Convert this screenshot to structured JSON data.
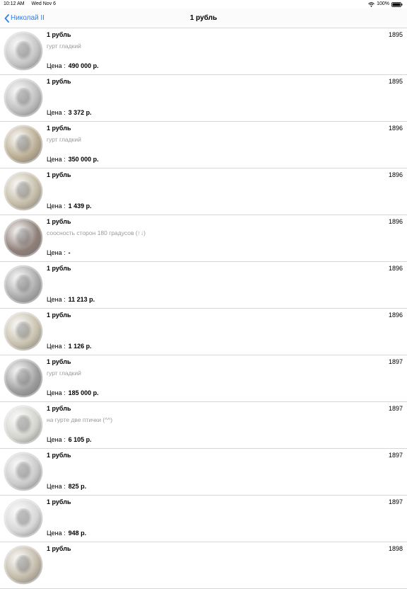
{
  "status": {
    "time": "10:12 AM",
    "date": "Wed Nov 6",
    "battery": "100%",
    "icons": [
      "wifi-icon",
      "battery-icon"
    ]
  },
  "nav": {
    "back_label": "Николай II",
    "title": "1 рубль",
    "accent": "#2f80ed"
  },
  "price_label": "Цена :",
  "items": [
    {
      "name": "1 рубль",
      "year": "1895",
      "desc": "гурт гладкий",
      "price": "490 000 р.",
      "coin_color": "#c4c4c4"
    },
    {
      "name": "1 рубль",
      "year": "1895",
      "desc": "",
      "price": "3 372 р.",
      "coin_color": "#bdbdbd"
    },
    {
      "name": "1 рубль",
      "year": "1896",
      "desc": "гурт гладкий",
      "price": "350 000 р.",
      "coin_color": "#b9ac92"
    },
    {
      "name": "1 рубль",
      "year": "1896",
      "desc": "",
      "price": "1 439 р.",
      "coin_color": "#c4bba6"
    },
    {
      "name": "1 рубль",
      "year": "1896",
      "desc": "соосность сторон 180 градусов (↑↓)",
      "price": "-",
      "coin_color": "#8f7f78"
    },
    {
      "name": "1 рубль",
      "year": "1896",
      "desc": "",
      "price": "11 213 р.",
      "coin_color": "#a9a9a9"
    },
    {
      "name": "1 рубль",
      "year": "1896",
      "desc": "",
      "price": "1 126 р.",
      "coin_color": "#c7c0ad"
    },
    {
      "name": "1 рубль",
      "year": "1897",
      "desc": "гурт гладкий",
      "price": "185 000 р.",
      "coin_color": "#9d9d9d"
    },
    {
      "name": "1 рубль",
      "year": "1897",
      "desc": "на гурте две птички (^^)",
      "price": "6 105 р.",
      "coin_color": "#d3d3cd"
    },
    {
      "name": "1 рубль",
      "year": "1897",
      "desc": "",
      "price": "825 р.",
      "coin_color": "#c9c9c9"
    },
    {
      "name": "1 рубль",
      "year": "1897",
      "desc": "",
      "price": "948 р.",
      "coin_color": "#d6d6d6"
    },
    {
      "name": "1 рубль",
      "year": "1898",
      "desc": "",
      "price": "",
      "coin_color": "#c2b9a8"
    }
  ]
}
